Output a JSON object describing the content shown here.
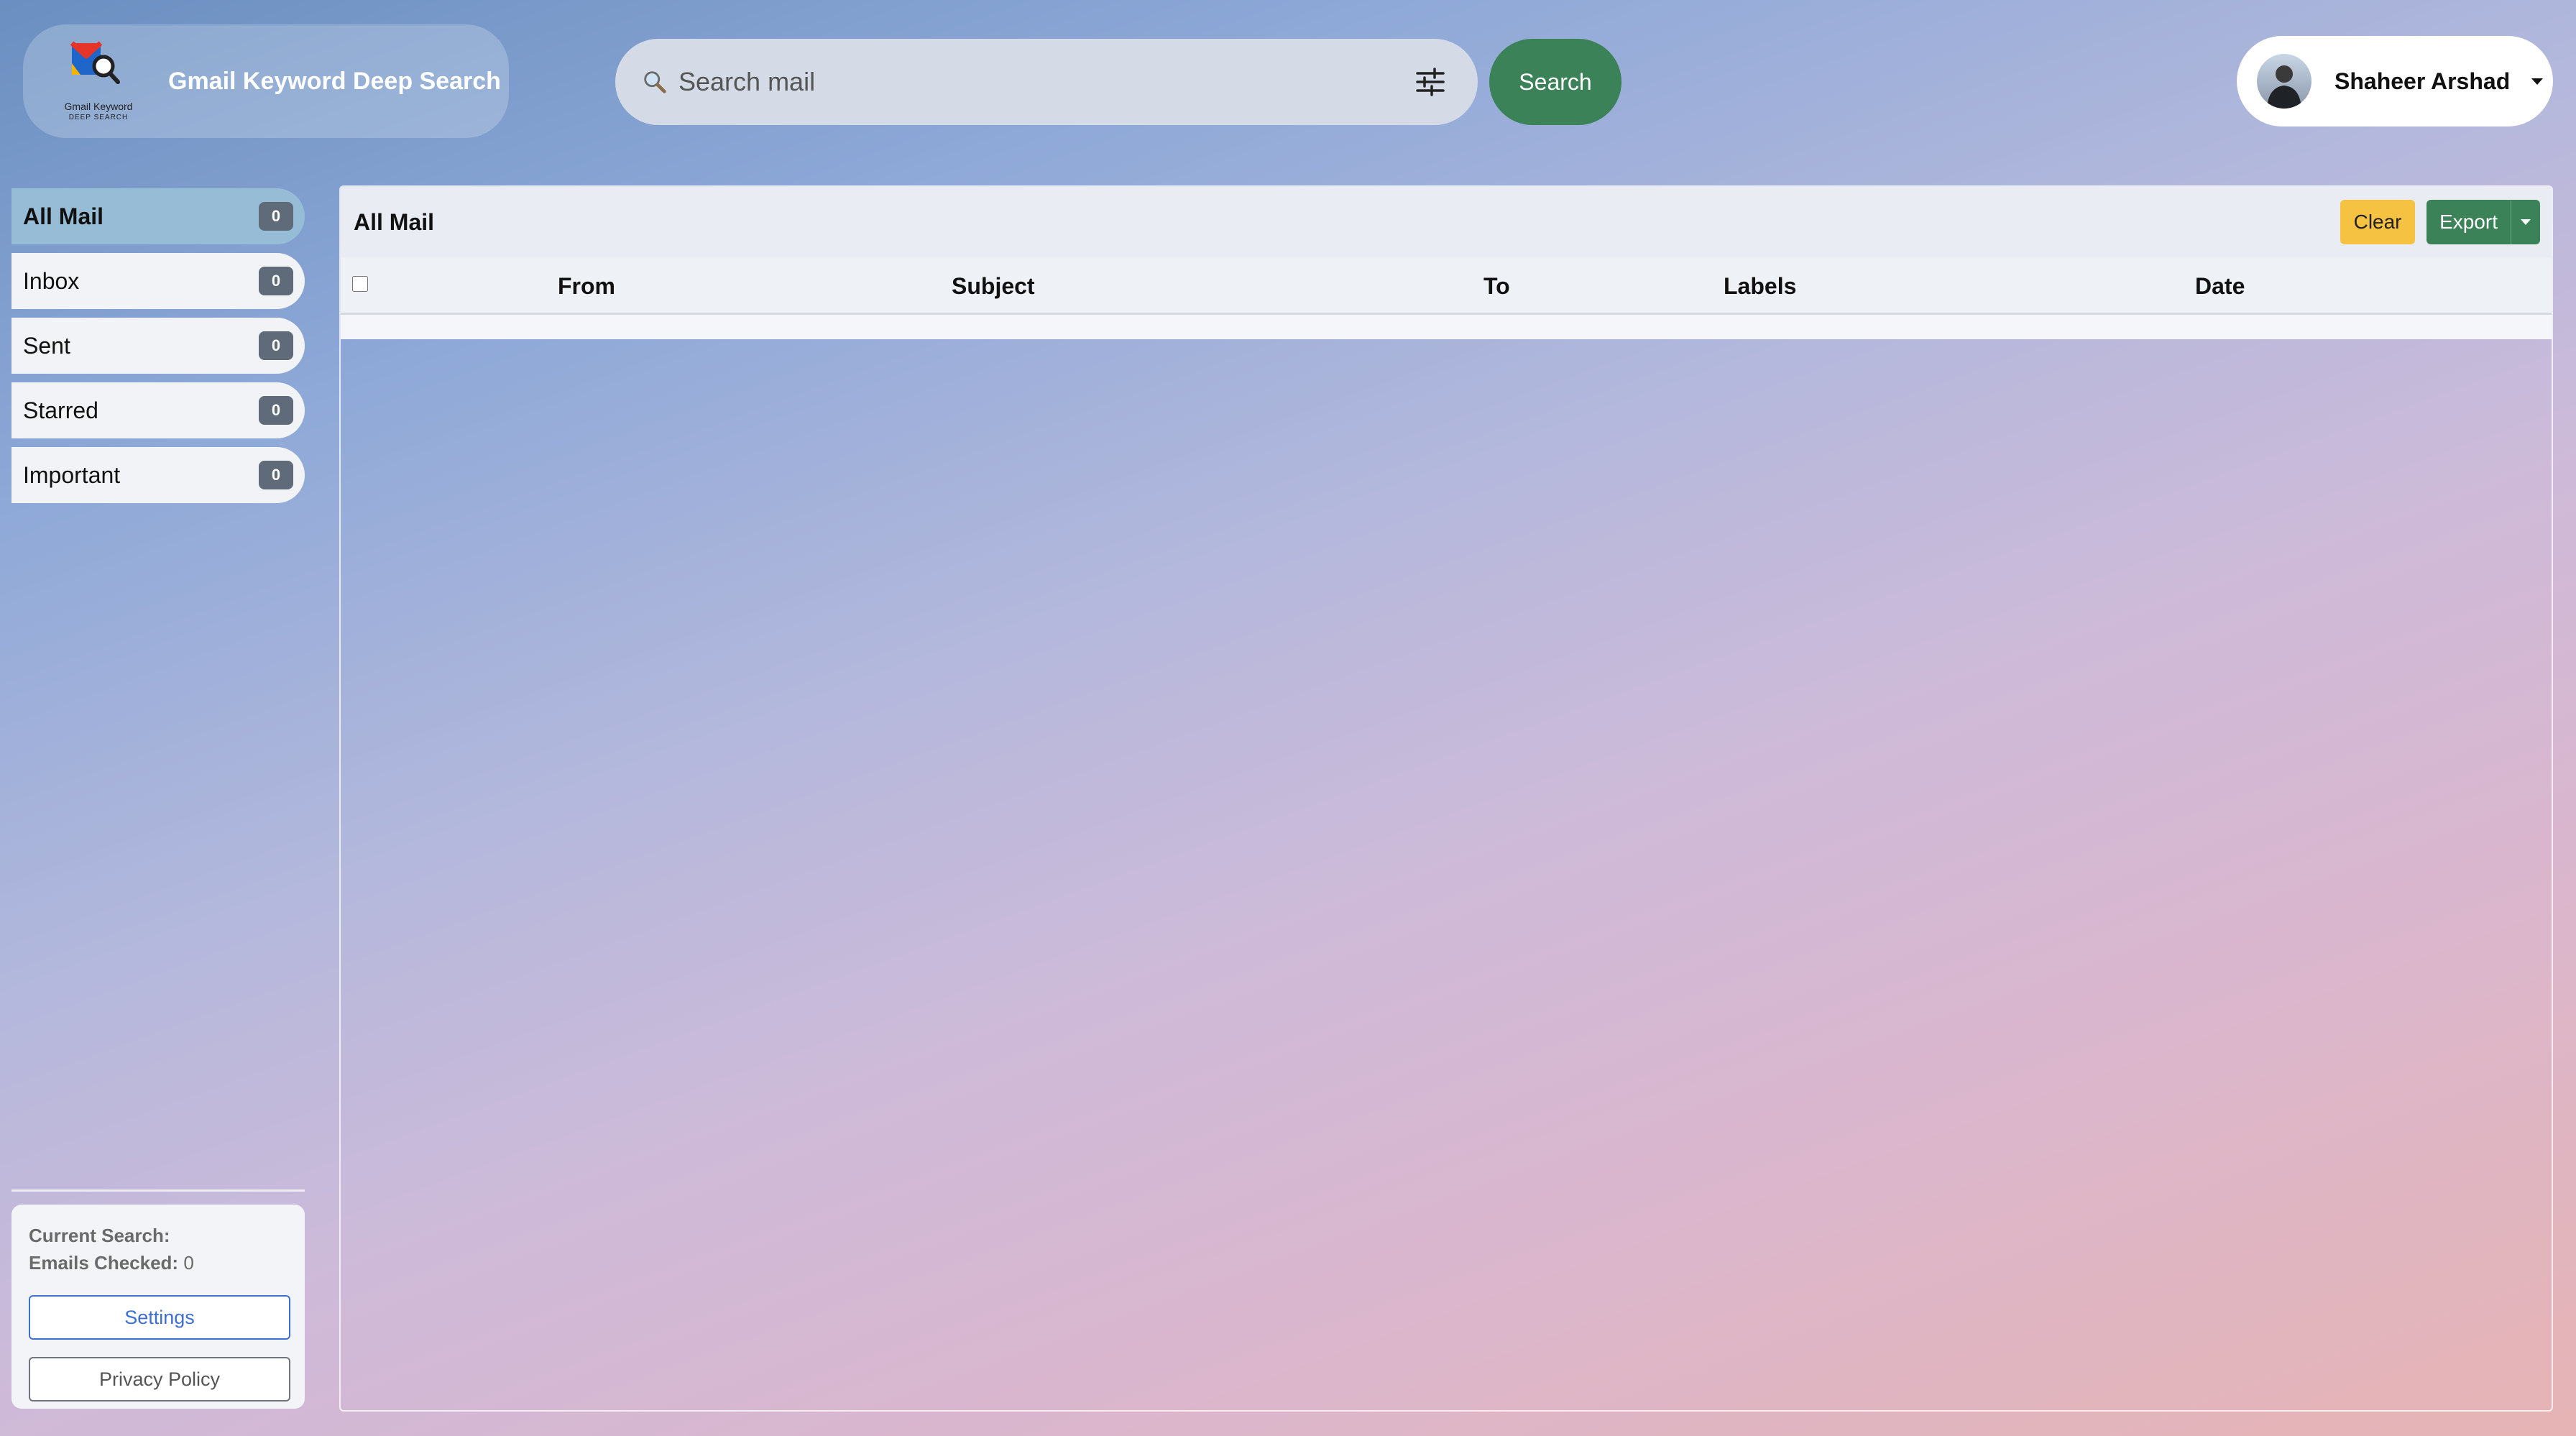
{
  "brand": {
    "title": "Gmail Keyword Deep Search",
    "logo_caption_line1": "Gmail Keyword",
    "logo_caption_line2": "DEEP SEARCH"
  },
  "search": {
    "placeholder": "Search mail",
    "value": "",
    "button_label": "Search"
  },
  "user": {
    "name": "Shaheer Arshad"
  },
  "sidebar": {
    "items": [
      {
        "label": "All Mail",
        "count": "0",
        "active": true
      },
      {
        "label": "Inbox",
        "count": "0",
        "active": false
      },
      {
        "label": "Sent",
        "count": "0",
        "active": false
      },
      {
        "label": "Starred",
        "count": "0",
        "active": false
      },
      {
        "label": "Important",
        "count": "0",
        "active": false
      }
    ],
    "status": {
      "current_search_label": "Current Search:",
      "current_search_value": "",
      "emails_checked_label": "Emails Checked:",
      "emails_checked_value": "0"
    },
    "settings_label": "Settings",
    "privacy_label": "Privacy Policy"
  },
  "main": {
    "title": "All Mail",
    "clear_label": "Clear",
    "export_label": "Export",
    "columns": [
      "From",
      "Subject",
      "To",
      "Labels",
      "Date"
    ]
  },
  "colors": {
    "accent_green": "#3b8258",
    "clear_yellow": "#f5c242",
    "active_nav": "#97bcd6",
    "link_blue": "#3f6fd0"
  }
}
